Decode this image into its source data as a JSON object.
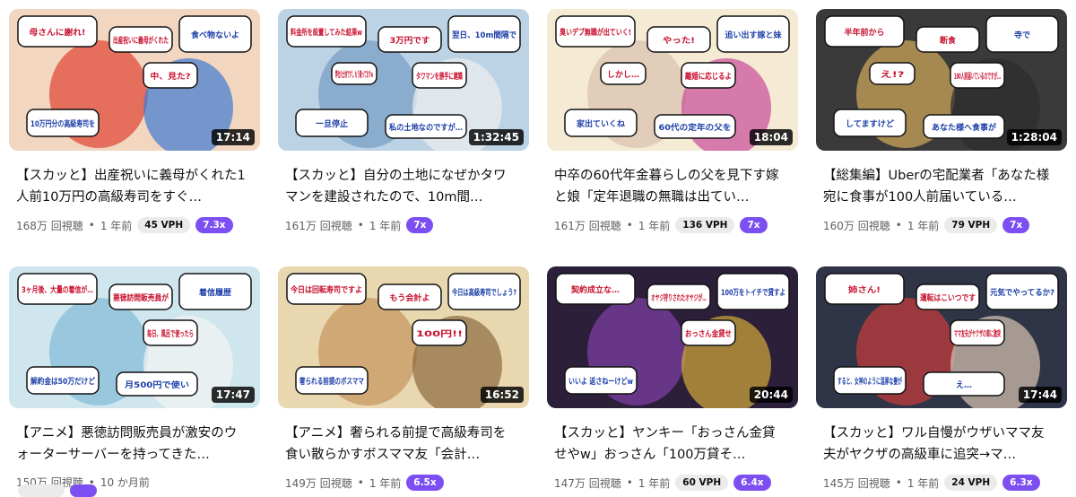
{
  "videos": [
    {
      "title": "【スカッと】出産祝いに義母がくれた1人前10万円の高級寿司をすぐ…",
      "duration": "17:14",
      "views": "168万 回視聴",
      "age": "1 年前",
      "vph": "45 VPH",
      "multiplier": "7.3x",
      "thumb_texts": [
        "母さんに謝れ!",
        "食べ物ないよ",
        "出産祝いに義母がくれた",
        "10万円分の高級寿司を",
        "中、見た?"
      ],
      "palette": [
        "#f2d6c0",
        "#e24b3b",
        "#3f7bd1"
      ]
    },
    {
      "title": "【スカッと】自分の土地になぜかタワマンを建設されたので、10m間…",
      "duration": "1:32:45",
      "views": "161万 回視聴",
      "age": "1 年前",
      "vph": "",
      "multiplier": "7x",
      "thumb_texts": [
        "料金所を設置してみた結果w",
        "翌日、10m間隔で",
        "3万円です",
        "一旦停止",
        "タワマンを勝手に建築",
        "私の土地なのですが…",
        "弊社の土地ですし もう建ってますw"
      ],
      "palette": [
        "#bcd3e6",
        "#7aa0c4",
        "#eeeeee"
      ]
    },
    {
      "title": "中卒の60代年金暮らしの父を見下す嫁と娘「定年退職の無職は出てい…",
      "duration": "18:04",
      "views": "161万 回視聴",
      "age": "1 年前",
      "vph": "136 VPH",
      "multiplier": "7x",
      "thumb_texts": [
        "臭いデブ無職が出ていく!",
        "追い出す嫁と妹",
        "やった!",
        "家出ていくね",
        "離婚に応じるよ",
        "60代の定年の父を",
        "しかし…"
      ],
      "palette": [
        "#f5ead4",
        "#d9c3b0",
        "#c94a9a"
      ]
    },
    {
      "title": "【総集編】Uberの宅配業者「あなた様宛に食事が100人前届いている…",
      "duration": "1:28:04",
      "views": "160万 回視聴",
      "age": "1 年前",
      "vph": "79 VPH",
      "multiplier": "7x",
      "thumb_texts": [
        "半年前から",
        "寺で",
        "断食",
        "してますけど",
        "100人前届いているのですが…",
        "あなた様へ食事が",
        "え!?"
      ],
      "palette": [
        "#3a3a3a",
        "#c9a45a",
        "#2c2c2c"
      ]
    },
    {
      "title": "【アニメ】悪徳訪問販売員が激安のウォーターサーバーを持ってきた…",
      "duration": "17:47",
      "views": "150万 回視聴",
      "age": "10 か月前",
      "vph": "",
      "multiplier": "",
      "thumb_texts": [
        "3ヶ月後、大量の着信が…",
        "着信履歴",
        "悪徳訪問販売員が",
        "解約金は50万だけど",
        "毎日、風呂で使ったら",
        "月500円で使い"
      ],
      "palette": [
        "#cfe6ef",
        "#86bcd8",
        "#f3f3f3"
      ]
    },
    {
      "title": "【アニメ】奢られる前提で高級寿司を食い散らかすボスママ友「会計…",
      "duration": "16:52",
      "views": "149万 回視聴",
      "age": "1 年前",
      "vph": "",
      "multiplier": "6.5x",
      "thumb_texts": [
        "今日は回転寿司ですよ",
        "今日は高級寿司でしょう?",
        "もう会計よ",
        "奢られる前提のボスママ",
        "100円!!"
      ],
      "palette": [
        "#e9d7b0",
        "#c79863",
        "#8a6a3f"
      ]
    },
    {
      "title": "【スカッと】ヤンキー「おっさん金貸せやw」おっさん「100万貸そ…",
      "duration": "20:44",
      "views": "147万 回視聴",
      "age": "1 年前",
      "vph": "60 VPH",
      "multiplier": "6.4x",
      "thumb_texts": [
        "契約成立な…",
        "100万をトイチで貸すよ",
        "オヤジ狩りされたオヤジが…",
        "いいよ 返さねーけどw",
        "おっさん金貸せ"
      ],
      "palette": [
        "#2b1f3a",
        "#7c3fa0",
        "#d4a93a"
      ]
    },
    {
      "title": "【スカッと】ワル自慢がウザいママ友夫がヤクザの高級車に追突→マ…",
      "duration": "17:44",
      "views": "145万 回視聴",
      "age": "1 年前",
      "vph": "24 VPH",
      "multiplier": "6.3x",
      "thumb_texts": [
        "姉さん!",
        "元気でやってるか?",
        "運転はこいつです",
        "すると、女神のように温厚な妻が",
        "ママ友夫がヤクザの車に激突",
        "え…"
      ],
      "palette": [
        "#2f3547",
        "#c23b3b",
        "#d8c6b3"
      ]
    }
  ],
  "peek_row": {
    "vph": "",
    "multiplier": ""
  }
}
